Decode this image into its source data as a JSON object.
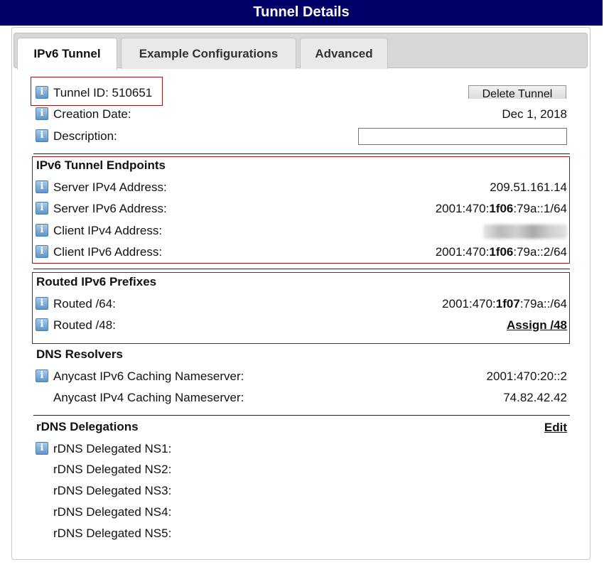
{
  "title": "Tunnel Details",
  "tabs": [
    {
      "label": "IPv6 Tunnel",
      "active": true
    },
    {
      "label": "Example Configurations",
      "active": false
    },
    {
      "label": "Advanced",
      "active": false
    }
  ],
  "tunnel": {
    "tunnel_id_label": "Tunnel ID: 510651",
    "delete_button": "Delete Tunnel",
    "creation_date_label": "Creation Date:",
    "creation_date_value": "Dec 1, 2018",
    "description_label": "Description:",
    "description_value": ""
  },
  "endpoints": {
    "heading": "IPv6 Tunnel Endpoints",
    "server_ipv4_label": "Server IPv4 Address:",
    "server_ipv4_value": "209.51.161.14",
    "server_ipv6_label": "Server IPv6 Address:",
    "server_ipv6_prefix": "2001:470:",
    "server_ipv6_bold": "1f06",
    "server_ipv6_suffix": ":79a::1/64",
    "client_ipv4_label": "Client IPv4 Address:",
    "client_ipv6_label": "Client IPv6 Address:",
    "client_ipv6_prefix": "2001:470:",
    "client_ipv6_bold": "1f06",
    "client_ipv6_suffix": ":79a::2/64"
  },
  "routed": {
    "heading": "Routed IPv6 Prefixes",
    "r64_label": "Routed /64:",
    "r64_prefix": "2001:470:",
    "r64_bold": "1f07",
    "r64_suffix": ":79a::/64",
    "r48_label": "Routed /48:",
    "r48_link": "Assign /48"
  },
  "dns": {
    "heading": "DNS Resolvers",
    "ipv6_label": "Anycast IPv6 Caching Nameserver:",
    "ipv6_value": "2001:470:20::2",
    "ipv4_label": "Anycast IPv4 Caching Nameserver:",
    "ipv4_value": "74.82.42.42"
  },
  "rdns": {
    "heading": "rDNS Delegations",
    "edit_link": "Edit",
    "ns": [
      "rDNS Delegated NS1:",
      "rDNS Delegated NS2:",
      "rDNS Delegated NS3:",
      "rDNS Delegated NS4:",
      "rDNS Delegated NS5:"
    ]
  },
  "info_icon_glyph": "i",
  "colors": {
    "titlebar": "#000068",
    "highlight_box": "#8b1a1a"
  }
}
